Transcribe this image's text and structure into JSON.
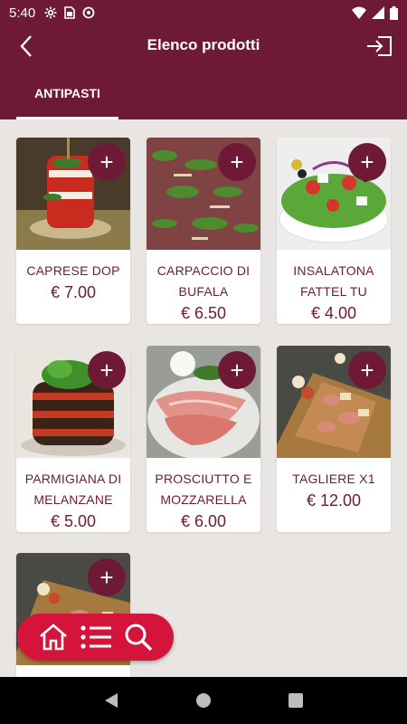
{
  "status": {
    "time": "5:40"
  },
  "appbar": {
    "title": "Elenco prodotti"
  },
  "tabs": [
    {
      "label": "ANTIPASTI"
    }
  ],
  "products": [
    {
      "name": "CAPRESE DOP",
      "price": "€ 7.00",
      "add_label": "+"
    },
    {
      "name": "CARPACCIO DI BUFALA",
      "price": "€ 6.50",
      "add_label": "+"
    },
    {
      "name": "INSALATONA FATTEL TU",
      "price": "€ 4.00",
      "add_label": "+"
    },
    {
      "name": "PARMIGIANA DI MELANZANE",
      "price": "€ 5.00",
      "add_label": "+"
    },
    {
      "name": "PROSCIUTTO E MOZZARELLA",
      "price": "€ 6.00",
      "add_label": "+"
    },
    {
      "name": "TAGLIERE X1",
      "price": "€ 12.00",
      "add_label": "+"
    },
    {
      "name": "",
      "price": "",
      "add_label": "+"
    }
  ],
  "colors": {
    "primary": "#6e1a36",
    "accent": "#d4143a",
    "background": "#e8e5e2"
  },
  "icons": {
    "back": "arrow-left-icon",
    "logout": "logout-icon",
    "fab": [
      "home-icon",
      "list-icon",
      "search-icon"
    ]
  }
}
